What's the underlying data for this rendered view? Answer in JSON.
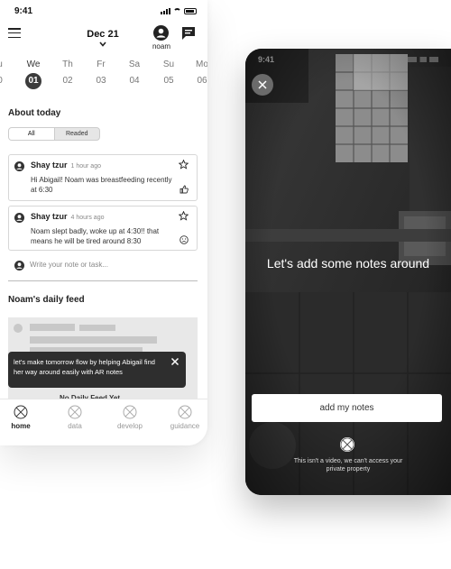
{
  "phone1": {
    "status_time": "9:41",
    "header": {
      "date": "Dec 21",
      "user_name": "noam"
    },
    "week": [
      {
        "day": "u",
        "date": "0"
      },
      {
        "day": "We",
        "date": "01",
        "active": true
      },
      {
        "day": "Th",
        "date": "02"
      },
      {
        "day": "Fr",
        "date": "03"
      },
      {
        "day": "Sa",
        "date": "04"
      },
      {
        "day": "Su",
        "date": "05"
      },
      {
        "day": "Mo",
        "date": "06"
      }
    ],
    "about": {
      "title": "About today",
      "filters": [
        "All",
        "Readed"
      ],
      "posts": [
        {
          "author": "Shay tzur",
          "time": "1 hour ago",
          "text": "Hi Abigail! Noam was breastfeeding recently at 6:30",
          "reaction": "thumbs-up-icon"
        },
        {
          "author": "Shay tzur",
          "time": "4 hours ago",
          "text": "Noam slept badly, woke up at 4:30!! that means he will be tired around 8:30",
          "reaction": "sad-face-icon"
        }
      ],
      "note_placeholder": "Write your note or task..."
    },
    "feed": {
      "title": "Noam's daily feed",
      "tooltip": "let's make tomorrow flow by helping Abigail find her way around easily with AR notes",
      "peek_text": "No Daily Feed Yet"
    },
    "tabs": [
      {
        "label": "home",
        "active": true
      },
      {
        "label": "data"
      },
      {
        "label": "develop"
      },
      {
        "label": "guidance"
      }
    ]
  },
  "phone2": {
    "status_time": "9:41",
    "headline": "Let's add some notes around",
    "button_label": "add my notes",
    "disclaimer": "This isn't a video, we can't access your private property"
  },
  "colors": {
    "dark_accent": "#3c3c3c",
    "tooltip_bg": "#2e2e2e",
    "overlay_bg": "#2a2a2a"
  }
}
